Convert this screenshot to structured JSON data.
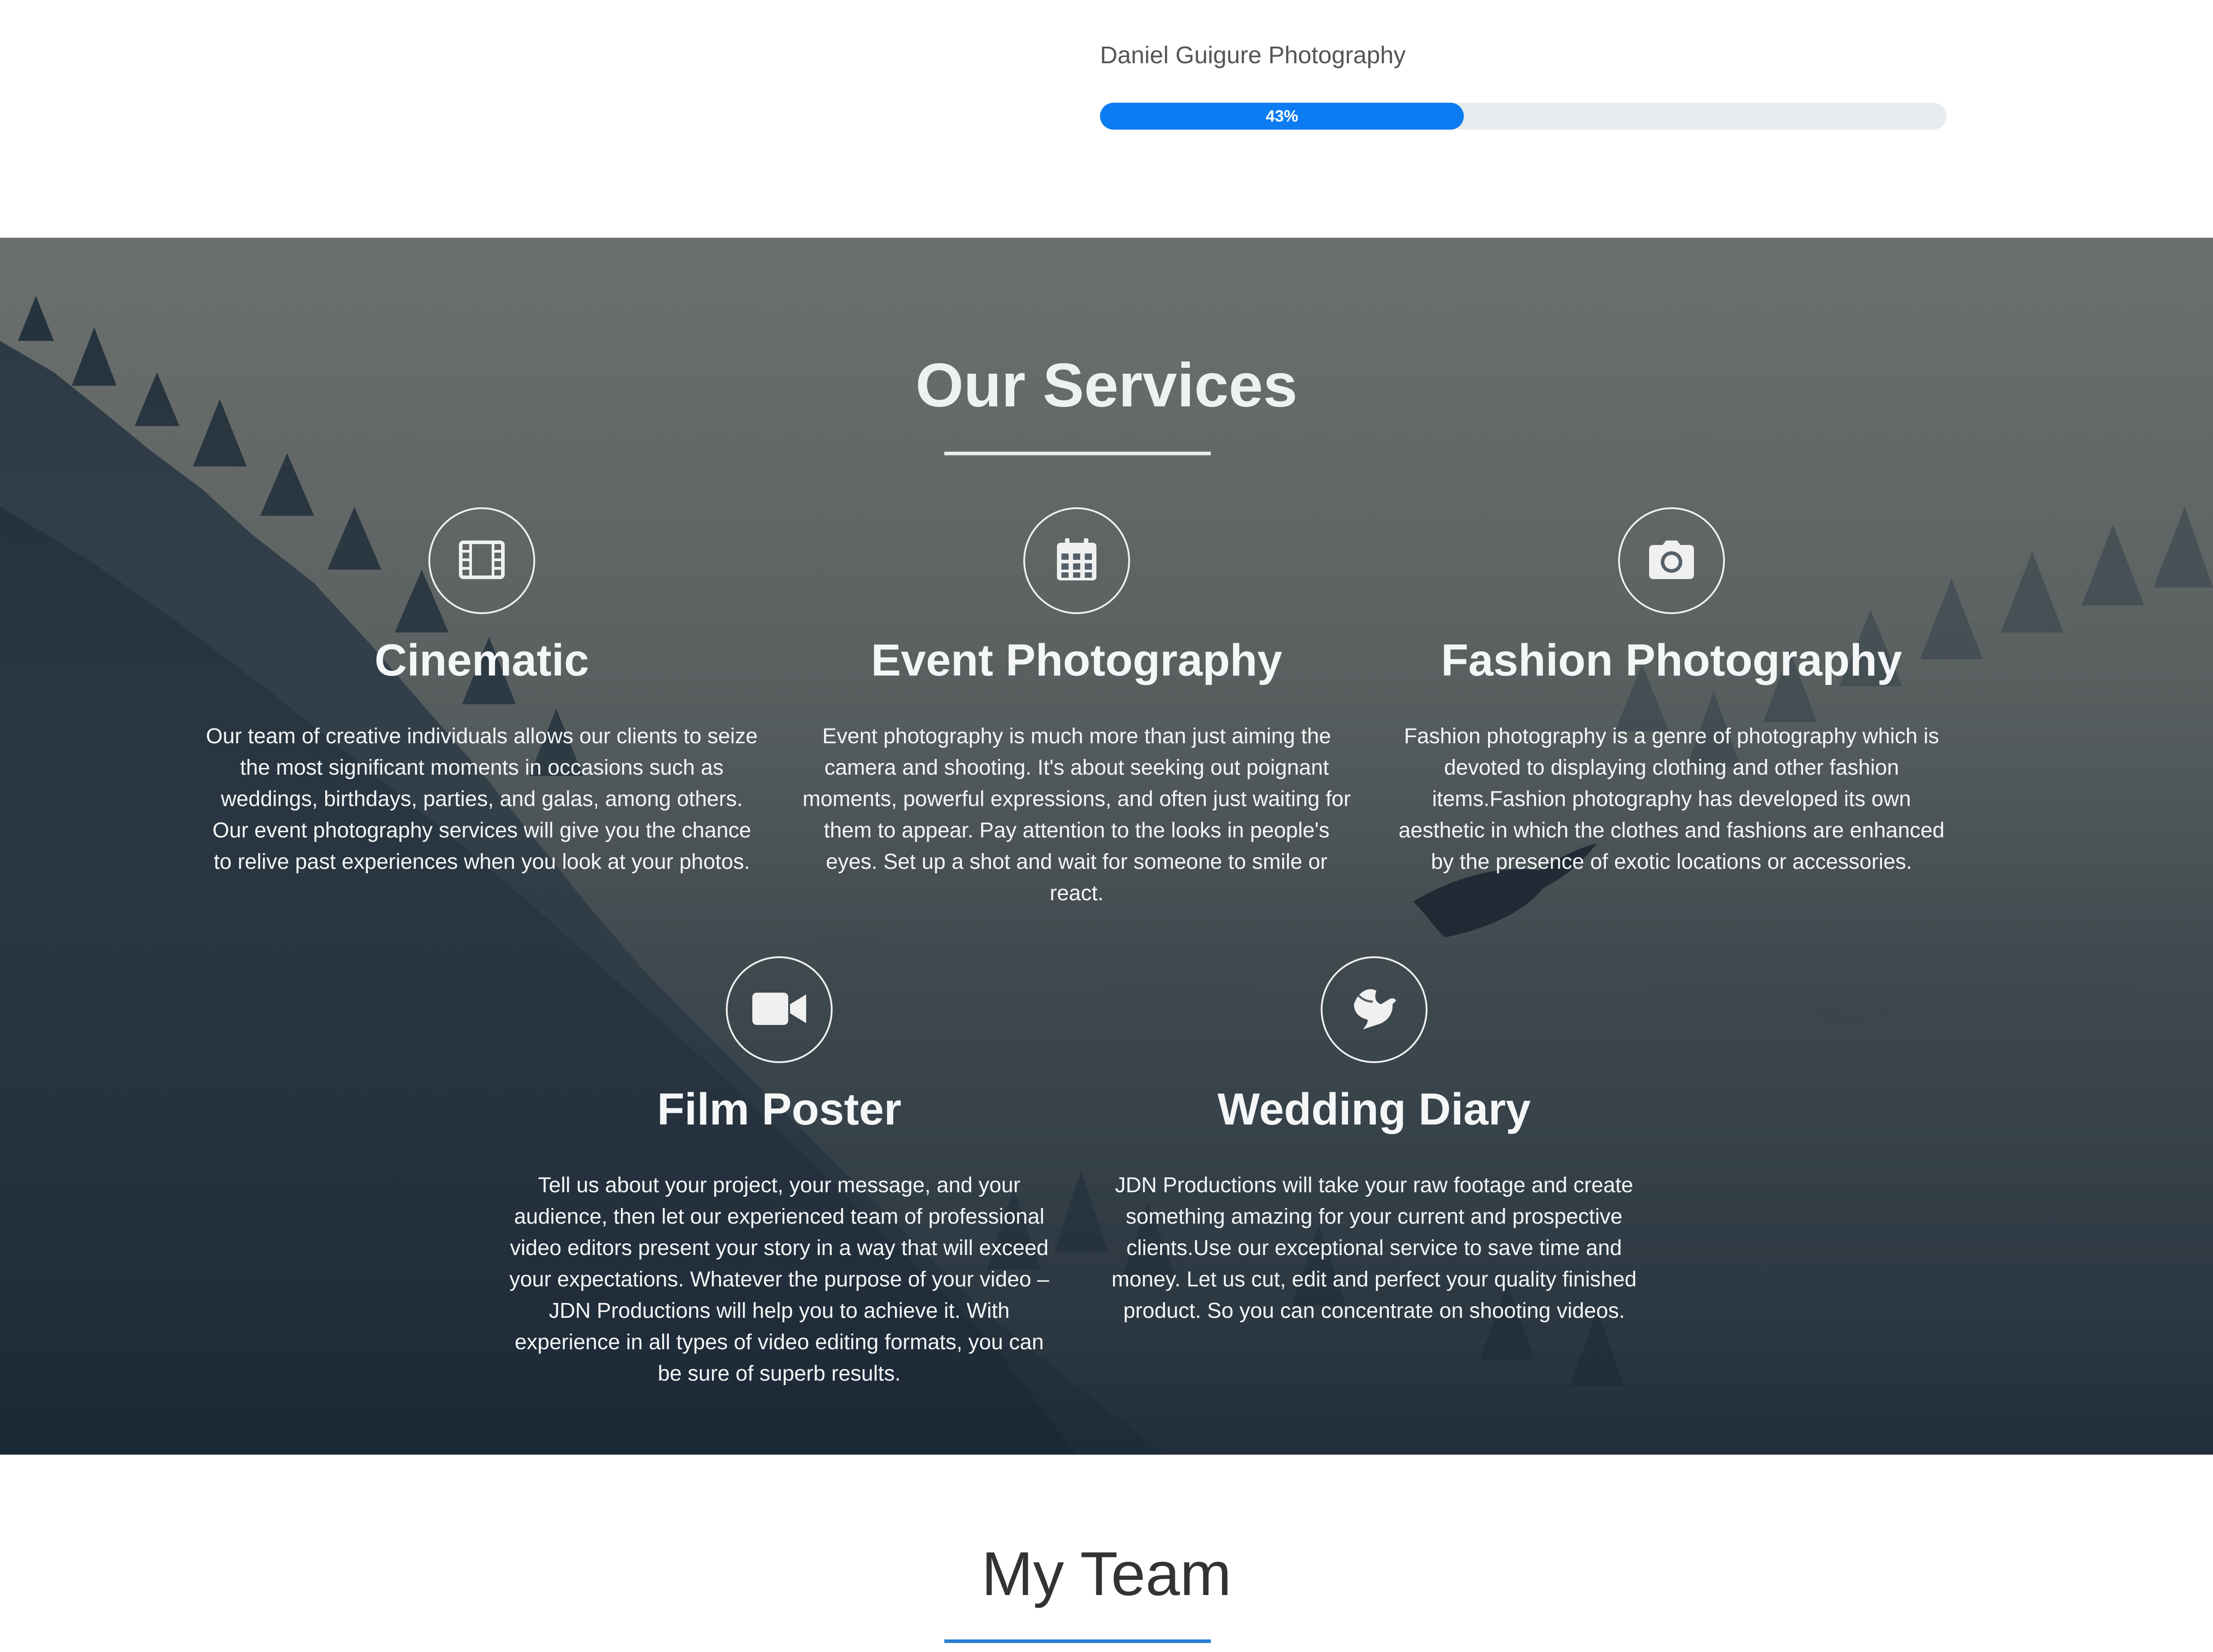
{
  "skills": {
    "label": "Daniel Guigure Photography",
    "percent_text": "43%",
    "percent": 43,
    "fill_color": "#0d7cf2",
    "track_color": "#e9ecef"
  },
  "services": {
    "title": "Our Services",
    "items": [
      {
        "icon": "film-icon",
        "title": "Cinematic",
        "description": "Our team of creative individuals allows our clients to seize the most significant moments in occasions such as weddings, birthdays, parties, and galas, among others. Our event photography services will give you the chance to relive past experiences when you look at your photos."
      },
      {
        "icon": "calendar-icon",
        "title": "Event Photography",
        "description": "Event photography is much more than just aiming the camera and shooting. It's about seeking out poignant moments, powerful expressions, and often just waiting for them to appear. Pay attention to the looks in people's eyes. Set up a shot and wait for someone to smile or react."
      },
      {
        "icon": "camera-icon",
        "title": "Fashion Photography",
        "description": "Fashion photography is a genre of photography which is devoted to displaying clothing and other fashion items.Fashion photography has developed its own aesthetic in which the clothes and fashions are enhanced by the presence of exotic locations or accessories."
      },
      {
        "icon": "video-camera-icon",
        "title": "Film Poster",
        "description": "Tell us about your project, your message, and your audience, then let our experienced team of professional video editors present your story in a way that will exceed your expectations. Whatever the purpose of your video – JDN Productions will help you to achieve it. With experience in all types of video editing formats, you can be sure of superb results."
      },
      {
        "icon": "dove-icon",
        "title": "Wedding Diary",
        "description": "JDN Productions will take your raw footage and create something amazing for your current and prospective clients.Use our exceptional service to save time and money. Let us cut, edit and perfect your quality finished product. So you can concentrate on shooting videos."
      }
    ]
  },
  "team": {
    "title": "My Team"
  }
}
